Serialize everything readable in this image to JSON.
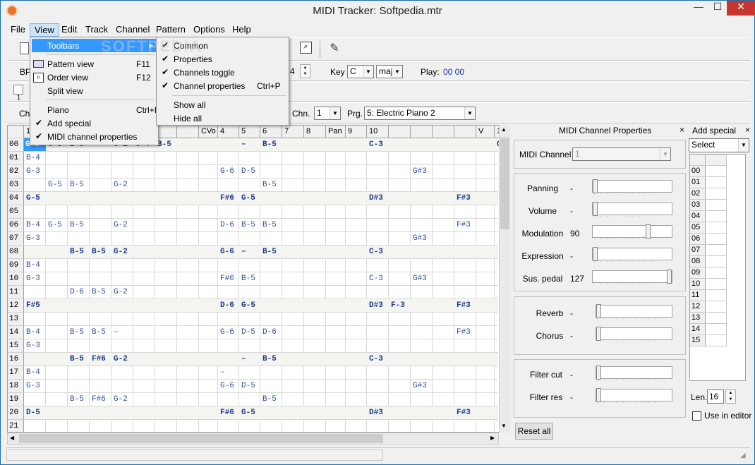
{
  "window": {
    "title": "MIDI Tracker: Softpedia.mtr",
    "minimize": "—",
    "restore": "☐",
    "close": "✕"
  },
  "menubar": [
    "File",
    "View",
    "Edit",
    "Track",
    "Channel",
    "Pattern",
    "Options",
    "Help"
  ],
  "watermark": "SOFTPEDIA",
  "toolbar2": {
    "bpm_label": "BPI",
    "tempo_value": "4",
    "key_label": "Key",
    "key_value": "C",
    "mode_value": "maj",
    "play_label": "Play:",
    "play_value": "00 00"
  },
  "toolbar3": {
    "toggle_label": "1"
  },
  "toolbar4": {
    "ch_label": "Ch",
    "chn_label": "Chn.",
    "chn_value": "1",
    "prg_label": "Prg.",
    "prg_value": "5: Electric Piano 2"
  },
  "view_menu": {
    "items": [
      {
        "label": "Toolbars",
        "shortcut": "",
        "checked": false
      },
      {
        "label": "Pattern view",
        "shortcut": "F11",
        "checked": false
      },
      {
        "label": "Order view",
        "shortcut": "F12",
        "checked": false
      },
      {
        "label": "Split view",
        "shortcut": "",
        "checked": false
      },
      {
        "label": "Piano",
        "shortcut": "Ctrl+I",
        "checked": false
      },
      {
        "label": "Add special",
        "shortcut": "",
        "checked": true
      },
      {
        "label": "MIDI channel properties",
        "shortcut": "",
        "checked": true
      }
    ]
  },
  "toolbars_submenu": {
    "items": [
      {
        "label": "Common",
        "shortcut": ""
      },
      {
        "label": "Properties",
        "shortcut": ""
      },
      {
        "label": "Channels toggle",
        "shortcut": ""
      },
      {
        "label": "Channel properties",
        "shortcut": "Ctrl+P"
      },
      {
        "label": "Show all",
        "shortcut": ""
      },
      {
        "label": "Hide all",
        "shortcut": ""
      }
    ],
    "checkmark": "✔"
  },
  "grid": {
    "headers": [
      "1",
      "",
      "",
      "",
      "",
      "",
      "",
      "",
      "CVo",
      "4",
      "5",
      "6",
      "7",
      "8",
      "Pan",
      "9",
      "10",
      "",
      "",
      "",
      "",
      "V",
      "1"
    ],
    "rows": [
      {
        "n": "00",
        "c": [
          "G-5",
          "G-5",
          "B-5",
          "",
          "G-2",
          "G-4",
          "B-5",
          "",
          "",
          "",
          "–",
          "B-5",
          "",
          "",
          "",
          "",
          "C-3",
          "",
          "",
          "",
          "",
          "",
          "G"
        ]
      },
      {
        "n": "01",
        "c": [
          "B-4",
          "",
          "",
          "",
          "",
          "",
          "",
          "",
          "",
          "",
          "",
          "",
          "",
          "",
          "",
          "",
          "",
          "",
          "",
          "",
          "",
          "",
          ""
        ]
      },
      {
        "n": "02",
        "c": [
          "G-3",
          "",
          "",
          "",
          "",
          "",
          "",
          "",
          "",
          "G-6",
          "D-5",
          "",
          "",
          "",
          "",
          "",
          "",
          "",
          "G#3",
          "",
          "",
          "",
          ""
        ]
      },
      {
        "n": "03",
        "c": [
          "",
          "G-5",
          "B-5",
          "",
          "G-2",
          "",
          "",
          "",
          "",
          "",
          "",
          "B-5",
          "",
          "",
          "",
          "",
          "",
          "",
          "",
          "",
          "",
          "",
          ""
        ]
      },
      {
        "n": "04",
        "c": [
          "G-5",
          "",
          "",
          "",
          "",
          "",
          "",
          "",
          "",
          "F#6",
          "G-5",
          "",
          "",
          "",
          "",
          "",
          "D#3",
          "",
          "",
          "",
          "F#3",
          "",
          ""
        ]
      },
      {
        "n": "05",
        "c": [
          "",
          "",
          "",
          "",
          "",
          "",
          "",
          "",
          "",
          "",
          "",
          "",
          "",
          "",
          "",
          "",
          "",
          "",
          "",
          "",
          "",
          "",
          ""
        ]
      },
      {
        "n": "06",
        "c": [
          "B-4",
          "G-5",
          "B-5",
          "",
          "G-2",
          "",
          "",
          "",
          "",
          "D-6",
          "B-5",
          "B-5",
          "",
          "",
          "",
          "",
          "",
          "",
          "",
          "",
          "F#3",
          "",
          ""
        ]
      },
      {
        "n": "07",
        "c": [
          "G-3",
          "",
          "",
          "",
          "",
          "",
          "",
          "",
          "",
          "",
          "",
          "",
          "",
          "",
          "",
          "",
          "",
          "",
          "G#3",
          "",
          "",
          "",
          ""
        ]
      },
      {
        "n": "08",
        "c": [
          "",
          "",
          "B-5",
          "B-5",
          "G-2",
          "",
          "",
          "",
          "",
          "G-6",
          "–",
          "B-5",
          "",
          "",
          "",
          "",
          "C-3",
          "",
          "",
          "",
          "",
          "",
          ""
        ]
      },
      {
        "n": "09",
        "c": [
          "B-4",
          "",
          "",
          "",
          "",
          "",
          "",
          "",
          "",
          "",
          "",
          "",
          "",
          "",
          "",
          "",
          "",
          "",
          "",
          "",
          "",
          "",
          ""
        ]
      },
      {
        "n": "10",
        "c": [
          "G-3",
          "",
          "",
          "",
          "",
          "",
          "",
          "",
          "",
          "F#6",
          "B-5",
          "",
          "",
          "",
          "",
          "",
          "C-3",
          "",
          "G#3",
          "",
          "",
          "",
          ""
        ]
      },
      {
        "n": "11",
        "c": [
          "",
          "",
          "D-6",
          "B-5",
          "G-2",
          "",
          "",
          "",
          "",
          "",
          "",
          "",
          "",
          "",
          "",
          "",
          "",
          "",
          "",
          "",
          "",
          "",
          ""
        ]
      },
      {
        "n": "12",
        "c": [
          "F#5",
          "",
          "",
          "",
          "",
          "",
          "",
          "",
          "",
          "D-6",
          "G-5",
          "",
          "",
          "",
          "",
          "",
          "D#3",
          "F-3",
          "",
          "",
          "F#3",
          "",
          ""
        ]
      },
      {
        "n": "13",
        "c": [
          "",
          "",
          "",
          "",
          "",
          "",
          "",
          "",
          "",
          "",
          "",
          "",
          "",
          "",
          "",
          "",
          "",
          "",
          "",
          "",
          "",
          "",
          ""
        ]
      },
      {
        "n": "14",
        "c": [
          "B-4",
          "",
          "B-5",
          "B-5",
          "–",
          "",
          "",
          "",
          "",
          "G-6",
          "D-5",
          "D-6",
          "",
          "",
          "",
          "",
          "",
          "",
          "",
          "",
          "F#3",
          "",
          ""
        ]
      },
      {
        "n": "15",
        "c": [
          "G-3",
          "",
          "",
          "",
          "",
          "",
          "",
          "",
          "",
          "",
          "",
          "",
          "",
          "",
          "",
          "",
          "",
          "",
          "",
          "",
          "",
          "",
          ""
        ]
      },
      {
        "n": "16",
        "c": [
          "",
          "",
          "B-5",
          "F#6",
          "G-2",
          "",
          "",
          "",
          "",
          "",
          "–",
          "B-5",
          "",
          "",
          "",
          "",
          "C-3",
          "",
          "",
          "",
          "",
          "",
          ""
        ]
      },
      {
        "n": "17",
        "c": [
          "B-4",
          "",
          "",
          "",
          "",
          "",
          "",
          "",
          "",
          "–",
          "",
          "",
          "",
          "",
          "",
          "",
          "",
          "",
          "",
          "",
          "",
          "",
          ""
        ]
      },
      {
        "n": "18",
        "c": [
          "G-3",
          "",
          "",
          "",
          "",
          "",
          "",
          "",
          "",
          "G-6",
          "D-5",
          "",
          "",
          "",
          "",
          "",
          "",
          "",
          "G#3",
          "",
          "",
          "",
          ""
        ]
      },
      {
        "n": "19",
        "c": [
          "",
          "",
          "B-5",
          "F#6",
          "G-2",
          "",
          "",
          "",
          "",
          "",
          "",
          "B-5",
          "",
          "",
          "",
          "",
          "",
          "",
          "",
          "",
          "",
          "",
          ""
        ]
      },
      {
        "n": "20",
        "c": [
          "D-5",
          "",
          "",
          "",
          "",
          "",
          "",
          "",
          "",
          "F#6",
          "G-5",
          "",
          "",
          "",
          "",
          "",
          "D#3",
          "",
          "",
          "",
          "F#3",
          "",
          ""
        ]
      },
      {
        "n": "21",
        "c": [
          "",
          "",
          "",
          "",
          "",
          "",
          "",
          "",
          "",
          "",
          "",
          "",
          "",
          "",
          "",
          "",
          "",
          "",
          "",
          "",
          "",
          "",
          ""
        ]
      }
    ]
  },
  "channel_props": {
    "title": "MIDI Channel Properties",
    "close": "×",
    "midi_channel_label": "MIDI Channel",
    "midi_channel_value": "1",
    "sliders": [
      {
        "label": "Panning",
        "value": "-",
        "level": 0
      },
      {
        "label": "Volume",
        "value": "-",
        "level": 0
      },
      {
        "label": "Modulation",
        "value": "90",
        "level": 0.71
      },
      {
        "label": "Expression",
        "value": "-",
        "level": 0
      },
      {
        "label": "Sus. pedal",
        "value": "127",
        "level": 1
      }
    ],
    "fx_sliders": [
      {
        "label": "Reverb",
        "value": "-",
        "level": 0
      },
      {
        "label": "Chorus",
        "value": "-",
        "level": 0
      }
    ],
    "filter_sliders": [
      {
        "label": "Filter cut",
        "value": "-",
        "level": 0
      },
      {
        "label": "Filter res",
        "value": "-",
        "level": 0
      }
    ],
    "reset_label": "Reset all"
  },
  "add_special": {
    "title": "Add special",
    "close": "×",
    "select_value": "Select",
    "rows": [
      "00",
      "01",
      "02",
      "03",
      "04",
      "05",
      "06",
      "07",
      "08",
      "09",
      "10",
      "11",
      "12",
      "13",
      "14",
      "15"
    ],
    "len_label": "Len.",
    "len_value": "16",
    "use_in_editor_label": "Use in editor"
  }
}
